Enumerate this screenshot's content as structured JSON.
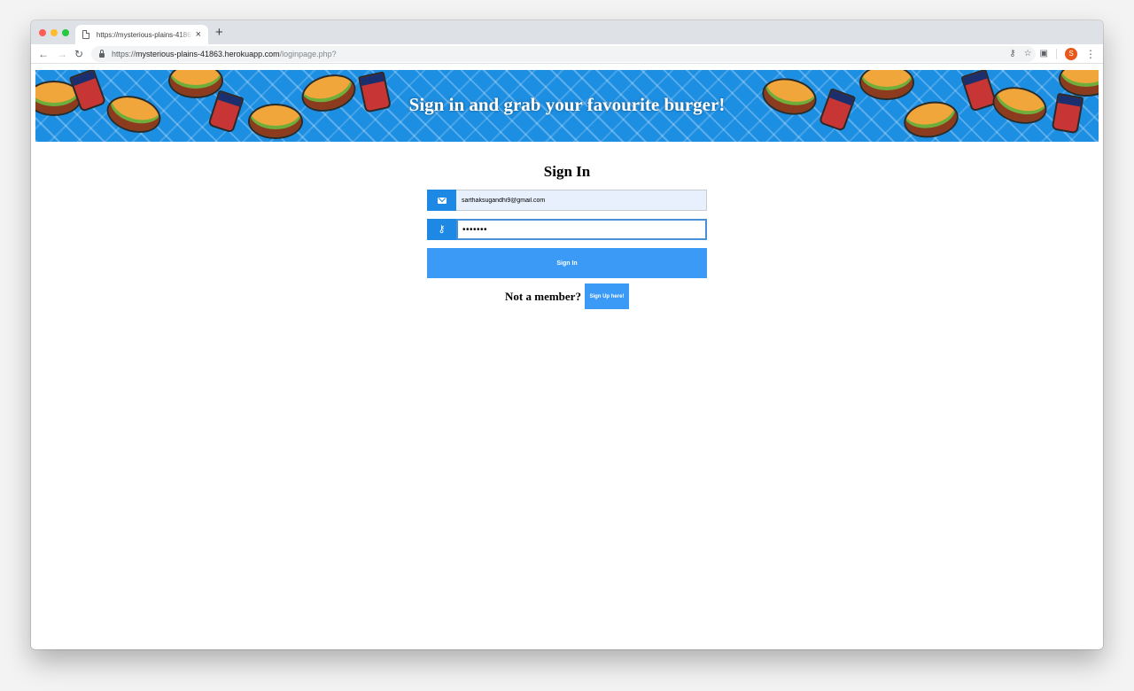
{
  "browser": {
    "tab_title": "https://mysterious-plains-41863.herokuapp.com/loginpage.php?",
    "tab_close": "×",
    "new_tab": "+",
    "url_scheme": "https://",
    "url_host": "mysterious-plains-41863.herokuapp.com",
    "url_path": "/loginpage.php?",
    "profile_initial": "S",
    "icons": {
      "back": "back-arrow-icon",
      "forward": "forward-arrow-icon",
      "reload": "reload-icon",
      "lock": "lock-icon",
      "key": "key-icon",
      "star": "star-icon",
      "camera": "camera-icon",
      "menu": "kebab-menu-icon"
    }
  },
  "banner": {
    "title": "Sign in and grab your favourite burger!",
    "background_color": "#1d8fe3"
  },
  "form": {
    "heading": "Sign In",
    "email_value": "sarthaksugandhi9@gmail.com",
    "password_value": "•••••••",
    "submit_label": "Sign In",
    "member_prompt": "Not a member?",
    "signup_label": "Sign Up here!",
    "accent_color": "#3a9af5"
  }
}
